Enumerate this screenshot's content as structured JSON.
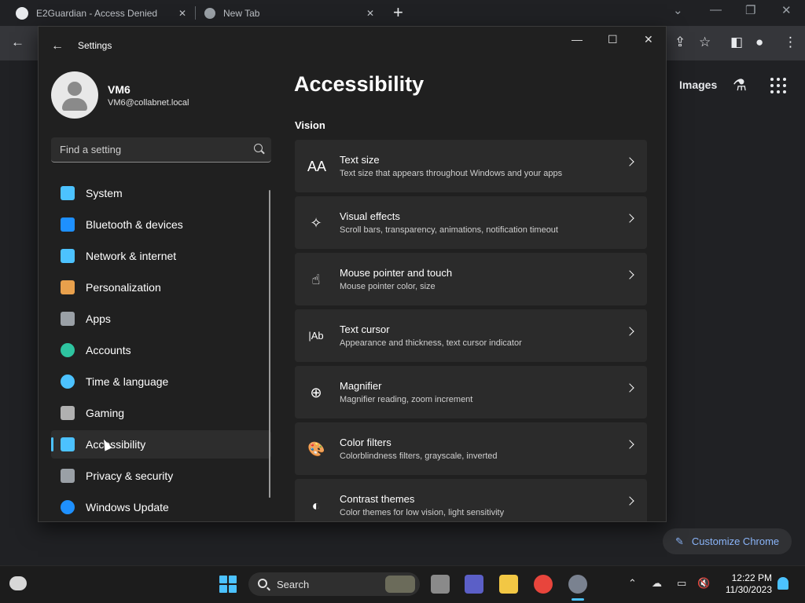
{
  "browser": {
    "tabs": [
      {
        "title": "E2Guardian - Access Denied",
        "favicon": "github-icon"
      },
      {
        "title": "New Tab",
        "favicon": "chrome-icon"
      }
    ],
    "new_tab_glyph": "+",
    "ntp": {
      "images_link": "Images",
      "customize_label": "Customize Chrome"
    }
  },
  "settings": {
    "window_title": "Settings",
    "user": {
      "name": "VM6",
      "email": "VM6@collabnet.local"
    },
    "search_placeholder": "Find a setting",
    "nav": [
      {
        "label": "System",
        "icon": "monitor-icon",
        "color": "#4cc2ff"
      },
      {
        "label": "Bluetooth & devices",
        "icon": "bluetooth-icon",
        "color": "#1e90ff"
      },
      {
        "label": "Network & internet",
        "icon": "wifi-icon",
        "color": "#4cc2ff"
      },
      {
        "label": "Personalization",
        "icon": "brush-icon",
        "color": "#e8a04c"
      },
      {
        "label": "Apps",
        "icon": "apps-icon",
        "color": "#9aa0a6"
      },
      {
        "label": "Accounts",
        "icon": "person-icon",
        "color": "#2ec4a0"
      },
      {
        "label": "Time & language",
        "icon": "globe-clock-icon",
        "color": "#4cc2ff"
      },
      {
        "label": "Gaming",
        "icon": "gamepad-icon",
        "color": "#b0b0b0"
      },
      {
        "label": "Accessibility",
        "icon": "accessibility-icon",
        "color": "#4cc2ff",
        "active": true
      },
      {
        "label": "Privacy & security",
        "icon": "shield-icon",
        "color": "#9aa0a6"
      },
      {
        "label": "Windows Update",
        "icon": "update-icon",
        "color": "#1e90ff"
      }
    ],
    "page_title": "Accessibility",
    "section": "Vision",
    "cards": [
      {
        "title": "Text size",
        "desc": "Text size that appears throughout Windows and your apps",
        "icon": "text-size-icon",
        "glyph": "AA"
      },
      {
        "title": "Visual effects",
        "desc": "Scroll bars, transparency, animations, notification timeout",
        "icon": "sparkle-icon",
        "glyph": "✧"
      },
      {
        "title": "Mouse pointer and touch",
        "desc": "Mouse pointer color, size",
        "icon": "pointer-touch-icon",
        "glyph": "☝"
      },
      {
        "title": "Text cursor",
        "desc": "Appearance and thickness, text cursor indicator",
        "icon": "text-cursor-icon",
        "glyph": "|Ab"
      },
      {
        "title": "Magnifier",
        "desc": "Magnifier reading, zoom increment",
        "icon": "magnifier-icon",
        "glyph": "⊕"
      },
      {
        "title": "Color filters",
        "desc": "Colorblindness filters, grayscale, inverted",
        "icon": "palette-icon",
        "glyph": "🎨"
      },
      {
        "title": "Contrast themes",
        "desc": "Color themes for low vision, light sensitivity",
        "icon": "contrast-icon",
        "glyph": "◐"
      }
    ]
  },
  "taskbar": {
    "search_label": "Search",
    "time": "12:22 PM",
    "date": "11/30/2023"
  }
}
